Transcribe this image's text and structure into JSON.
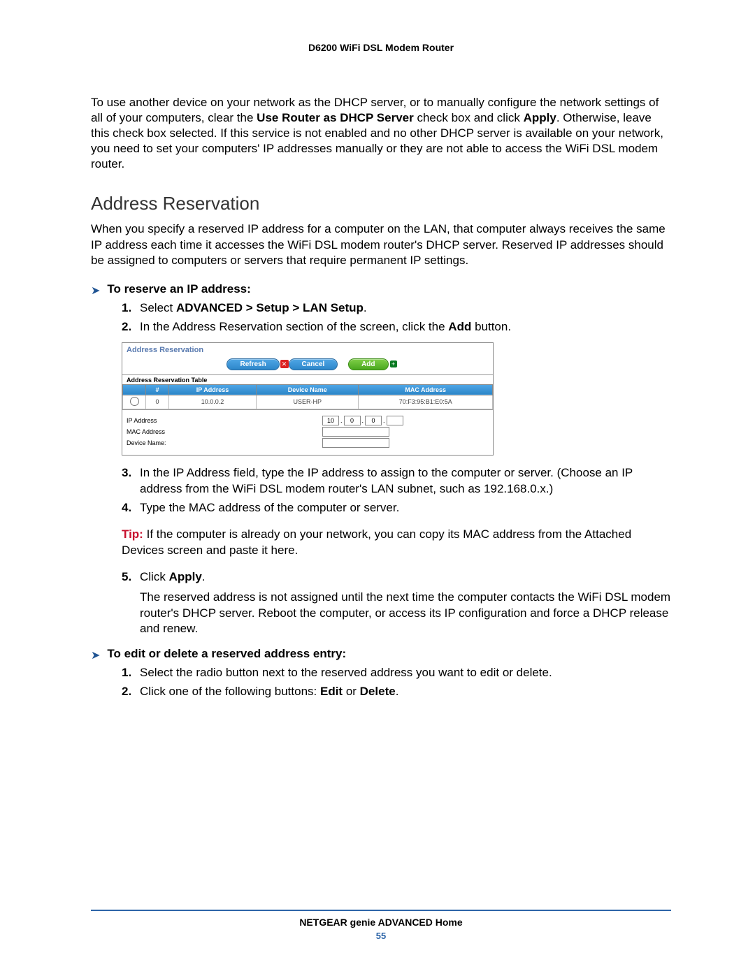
{
  "header": {
    "title": "D6200 WiFi DSL Modem Router"
  },
  "intro_para": {
    "t1": "To use another device on your network as the DHCP server, or to manually configure the network settings of all of your computers, clear the ",
    "b1": "Use Router as DHCP Server",
    "t2": " check box and click ",
    "b2": "Apply",
    "t3": ". Otherwise, leave this check box selected. If this service is not enabled and no other DHCP server is available on your network, you need to set your computers' IP addresses manually or they are not able to access the WiFi DSL modem router."
  },
  "section": {
    "heading": "Address Reservation",
    "para": "When you specify a reserved IP address for a computer on the LAN, that computer always receives the same IP address each time it accesses the WiFi DSL modem router's DHCP server. Reserved IP addresses should be assigned to computers or servers that require permanent IP settings."
  },
  "proc1": {
    "title": "To reserve an IP address:",
    "steps": {
      "s1": {
        "pre": "Select ",
        "bold": "ADVANCED > Setup > LAN Setup",
        "post": "."
      },
      "s2": {
        "t1": "In the Address Reservation section of the screen, click the ",
        "b1": "Add",
        "t2": " button."
      },
      "s3": "In the IP Address field, type the IP address to assign to the computer or server. (Choose an IP address from the WiFi DSL modem router's LAN subnet, such as 192.168.0.x.)",
      "s4": "Type the MAC address of the computer or server.",
      "s5": {
        "t1": "Click ",
        "b1": "Apply",
        "t2": "."
      },
      "s5b": "The reserved address is not assigned until the next time the computer contacts the WiFi DSL modem router's DHCP server. Reboot the computer, or access its IP configuration and force a DHCP release and renew."
    }
  },
  "tip": {
    "label": "Tip:",
    "text": "If the computer is already on your network, you can copy its MAC address from the Attached Devices screen and paste it here."
  },
  "proc2": {
    "title": "To edit or delete a reserved address entry:",
    "steps": {
      "s1": "Select the radio button next to the reserved address you want to edit or delete.",
      "s2": {
        "t1": "Click one of the following buttons: ",
        "b1": "Edit",
        "t2": " or ",
        "b2": "Delete",
        "t3": "."
      }
    }
  },
  "ui": {
    "title": "Address Reservation",
    "buttons": {
      "refresh": "Refresh",
      "cancel": "Cancel",
      "add": "Add"
    },
    "table_title": "Address Reservation Table",
    "headers": {
      "c0": "",
      "c1": "#",
      "c2": "IP Address",
      "c3": "Device Name",
      "c4": "MAC Address"
    },
    "row": {
      "idx": "0",
      "ip": "10.0.0.2",
      "dev": "USER-HP",
      "mac": "70:F3:95:B1:E0:5A"
    },
    "form": {
      "ip_lbl": "IP Address",
      "mac_lbl": "MAC Address",
      "dev_lbl": "Device Name:",
      "oct1": "10",
      "oct2": "0",
      "oct3": "0",
      "oct4": ""
    }
  },
  "footer": {
    "title": "NETGEAR genie ADVANCED Home",
    "page": "55"
  }
}
